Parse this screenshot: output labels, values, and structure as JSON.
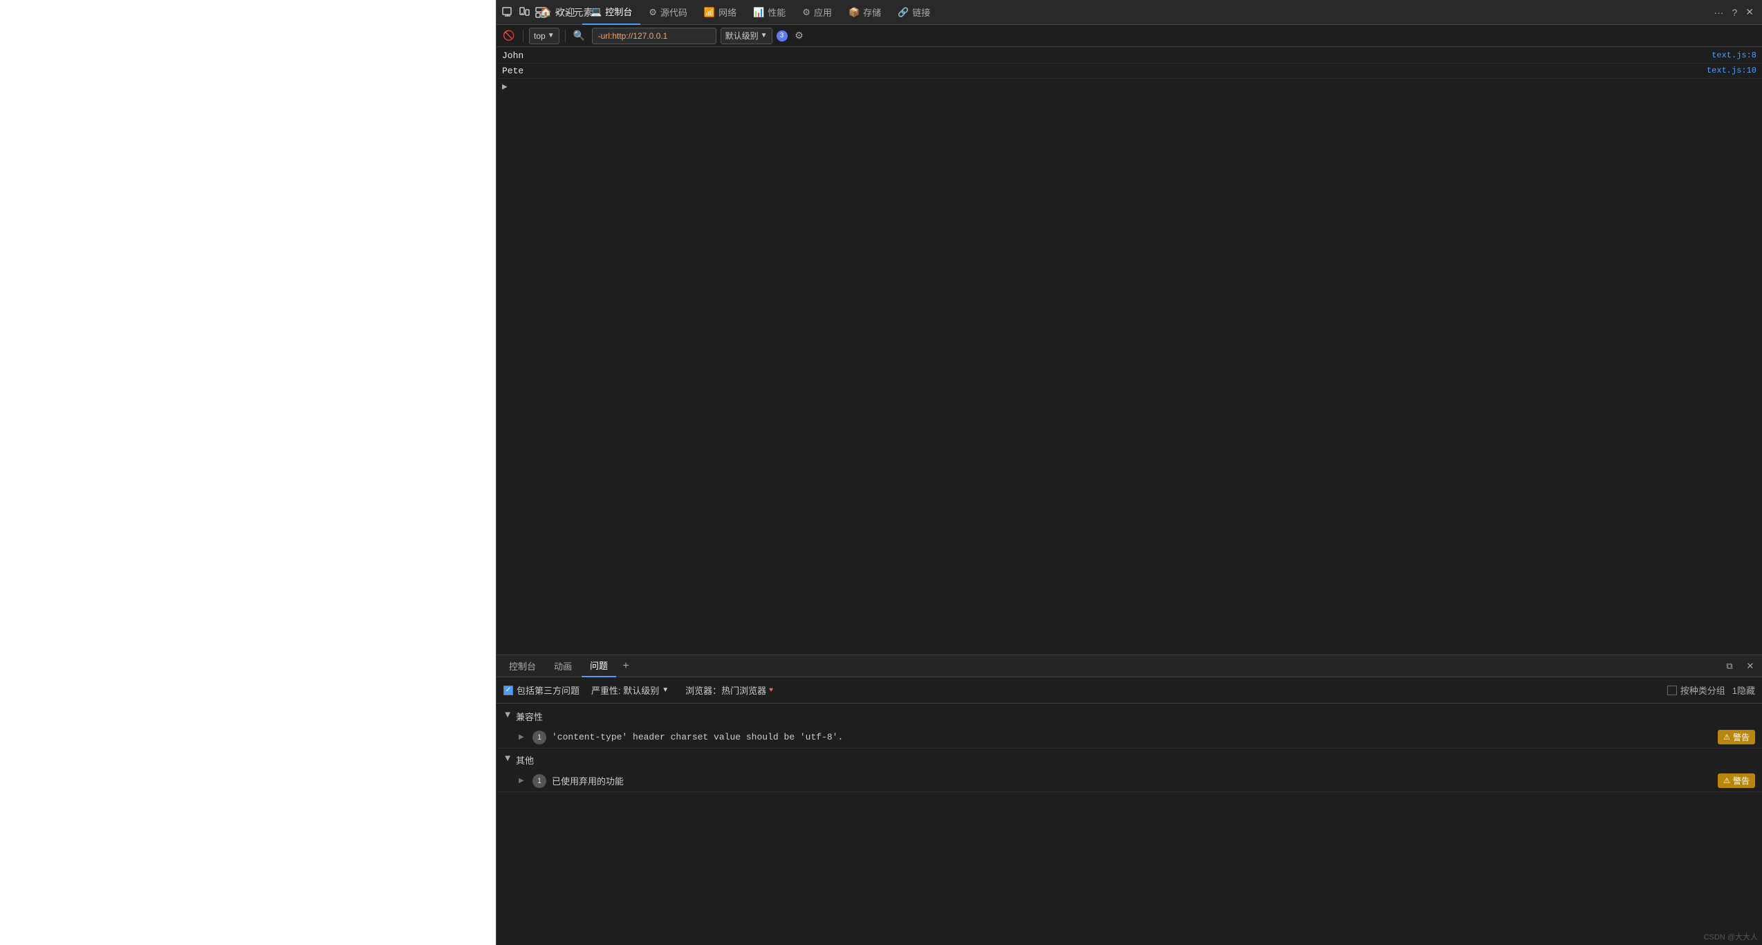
{
  "browser_page": {
    "background": "#ffffff"
  },
  "devtools": {
    "tabs": [
      {
        "id": "welcome",
        "label": "欢迎",
        "icon": "🏠",
        "active": false
      },
      {
        "id": "elements",
        "label": "元素",
        "icon": "</>",
        "active": false
      },
      {
        "id": "console",
        "label": "控制台",
        "icon": "💻",
        "active": true
      },
      {
        "id": "sources",
        "label": "源代码",
        "icon": "⚙",
        "active": false
      },
      {
        "id": "network",
        "label": "网络",
        "icon": "📶",
        "active": false
      },
      {
        "id": "performance",
        "label": "性能",
        "icon": "📊",
        "active": false
      },
      {
        "id": "application",
        "label": "应用",
        "icon": "⚙",
        "active": false
      },
      {
        "id": "storage",
        "label": "存储",
        "icon": "📦",
        "active": false
      },
      {
        "id": "links",
        "label": "链接",
        "icon": "🔗",
        "active": false
      }
    ],
    "toolbar": {
      "block_btn_title": "屏蔽",
      "top_dropdown": "top",
      "url_filter": "-url:http://127.0.0.1",
      "severity_label": "默认级别",
      "badge_count": "3",
      "settings_title": "设置"
    },
    "console_output": [
      {
        "id": "line-john",
        "text": "John",
        "source": "text.js:8"
      },
      {
        "id": "line-pete",
        "text": "Pete",
        "source": "text.js:10"
      }
    ],
    "bottom_panel": {
      "tabs": [
        {
          "id": "console-tab",
          "label": "控制台",
          "active": false
        },
        {
          "id": "animation-tab",
          "label": "动画",
          "active": false
        },
        {
          "id": "issues-tab",
          "label": "问题",
          "active": true
        }
      ],
      "filter": {
        "include_third_party_label": "包括第三方问题",
        "severity_label": "严重性: 默认级别",
        "browser_label": "浏览器：热门浏览器",
        "group_by_label": "按种类分组",
        "hide_count": "1隐藏"
      },
      "categories": [
        {
          "id": "compatibility",
          "label": "兼容性",
          "expanded": true,
          "items": [
            {
              "id": "content-type-issue",
              "count": "1",
              "text": "'content-type' header charset value should be 'utf-8'.",
              "severity": "警告"
            }
          ]
        },
        {
          "id": "other",
          "label": "其他",
          "expanded": true,
          "items": [
            {
              "id": "deprecated-feature",
              "count": "1",
              "text": "已使用弃用的功能",
              "severity": "警告"
            }
          ]
        }
      ]
    }
  },
  "watermark": {
    "text": "CSDN @大大人"
  }
}
